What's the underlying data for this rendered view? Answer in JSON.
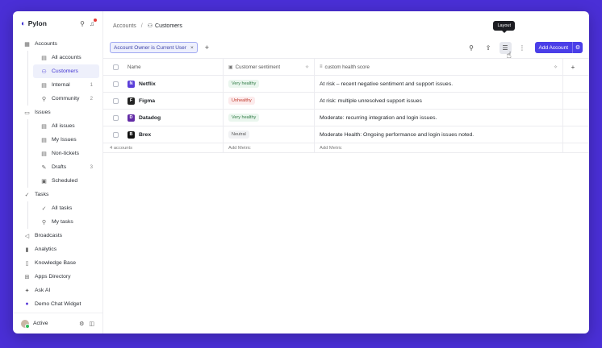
{
  "app": {
    "name": "Pylon"
  },
  "sidebar": {
    "accounts": {
      "label": "Accounts",
      "children": [
        {
          "label": "All accounts",
          "count": ""
        },
        {
          "label": "Customers",
          "count": ""
        },
        {
          "label": "Internal",
          "count": "1"
        },
        {
          "label": "Community",
          "count": "2"
        }
      ]
    },
    "issues": {
      "label": "Issues",
      "children": [
        {
          "label": "All issues",
          "count": ""
        },
        {
          "label": "My Issues",
          "count": ""
        },
        {
          "label": "Non-tickets",
          "count": ""
        },
        {
          "label": "Drafts",
          "count": "3"
        },
        {
          "label": "Scheduled",
          "count": ""
        }
      ]
    },
    "tasks": {
      "label": "Tasks",
      "children": [
        {
          "label": "All tasks"
        },
        {
          "label": "My tasks"
        }
      ]
    },
    "links": [
      {
        "label": "Broadcasts"
      },
      {
        "label": "Analytics"
      },
      {
        "label": "Knowledge Base"
      },
      {
        "label": "Apps Directory"
      },
      {
        "label": "Ask AI"
      },
      {
        "label": "Demo Chat Widget"
      }
    ],
    "status": "Active"
  },
  "breadcrumb": {
    "parent": "Accounts",
    "separator": "/",
    "current": "Customers"
  },
  "toolbar": {
    "filter": "Account Owner is Current User",
    "tooltip": "Layout",
    "add_label": "Add Account"
  },
  "table": {
    "columns": {
      "name": "Name",
      "sentiment": "Customer sentiment",
      "health": "custom health score"
    },
    "rows": [
      {
        "name": "Netflix",
        "logo": "N",
        "logo_color": "#5b3fd9",
        "sentiment": "Very healthy",
        "sentiment_bg": "#eaf6ee",
        "sentiment_fg": "#2f7a45",
        "health": "At risk – recent negative sentiment and support issues."
      },
      {
        "name": "Figma",
        "logo": "F",
        "logo_color": "#222222",
        "sentiment": "Unhealthy",
        "sentiment_bg": "#fcebec",
        "sentiment_fg": "#c0392b",
        "health": "At risk: multiple unresolved support issues"
      },
      {
        "name": "Datadog",
        "logo": "D",
        "logo_color": "#632ca6",
        "sentiment": "Very healthy",
        "sentiment_bg": "#eaf6ee",
        "sentiment_fg": "#2f7a45",
        "health": "Moderate: recurring integration and login issues."
      },
      {
        "name": "Brex",
        "logo": "B",
        "logo_color": "#111111",
        "sentiment": "Neutral",
        "sentiment_bg": "#f1f2f4",
        "sentiment_fg": "#555555",
        "health": "Moderate Health: Ongoing performance and login issues noted."
      }
    ],
    "footer": {
      "count": "4 accounts",
      "add_metric_1": "Add Metric",
      "add_metric_2": "Add Metric"
    }
  }
}
